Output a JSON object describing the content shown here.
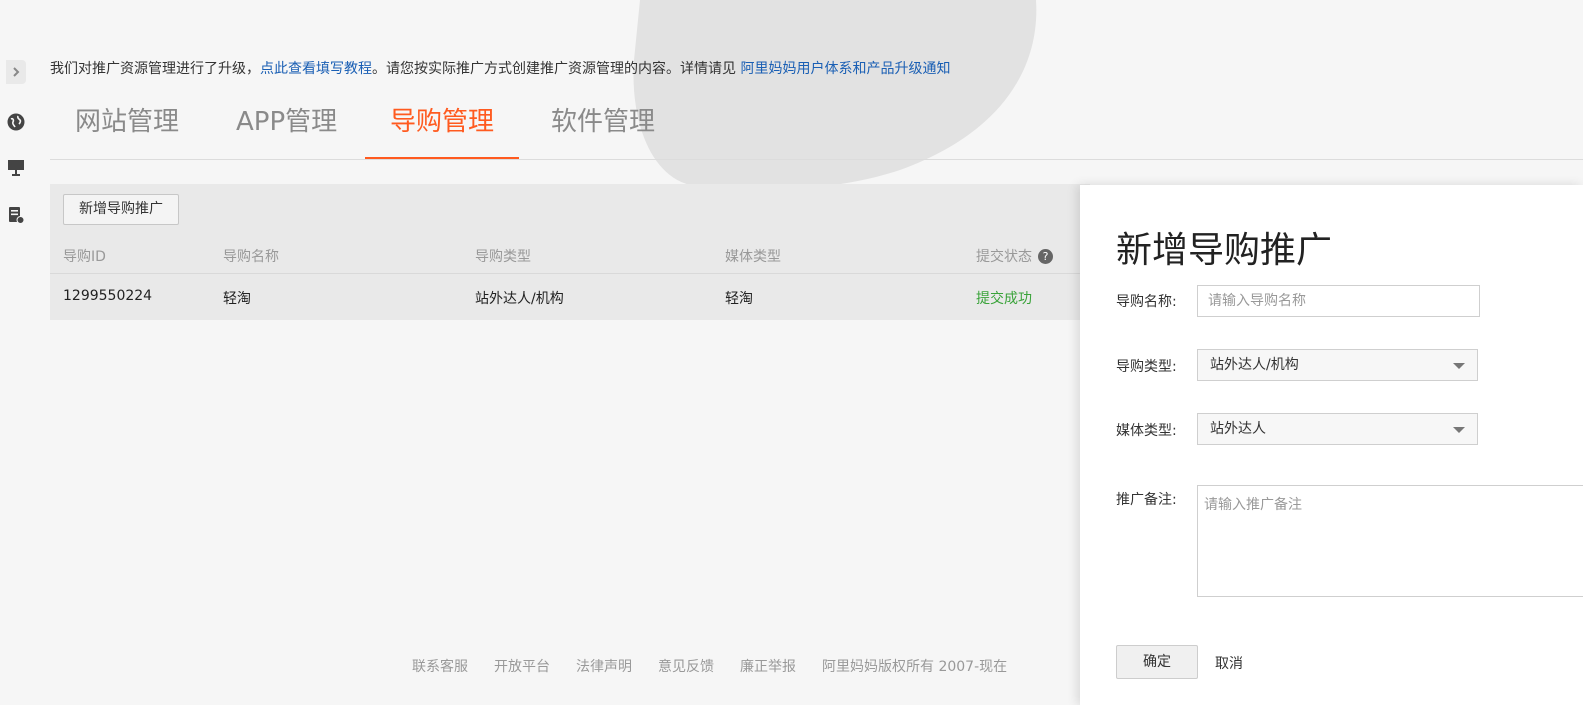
{
  "notice": {
    "prefix": "我们对推广资源管理进行了升级，",
    "tutorial_link": "点此查看填写教程",
    "middle": "。请您按实际推广方式创建推广资源管理的内容。详情请见 ",
    "upgrade_link": "阿里妈妈用户体系和产品升级通知"
  },
  "rail": {
    "toggle_icon": "chevron-right-icon",
    "icons": [
      "globe-icon",
      "monitor-icon",
      "document-list-icon"
    ]
  },
  "tabs": [
    {
      "label": "网站管理",
      "active": false
    },
    {
      "label": "APP管理",
      "active": false
    },
    {
      "label": "导购管理",
      "active": true
    },
    {
      "label": "软件管理",
      "active": false
    }
  ],
  "list": {
    "add_button": "新增导购推广",
    "columns": [
      "导购ID",
      "导购名称",
      "导购类型",
      "媒体类型",
      "提交状态"
    ],
    "help_glyph": "?",
    "rows": [
      {
        "id": "1299550224",
        "name": "轻淘",
        "type": "站外达人/机构",
        "media": "轻淘",
        "status": "提交成功"
      }
    ]
  },
  "footer": {
    "links": [
      "联系客服",
      "开放平台",
      "法律声明",
      "意见反馈",
      "廉正举报",
      "阿里妈妈版权所有 2007-现在"
    ]
  },
  "drawer": {
    "title": "新增导购推广",
    "name_label": "导购名称:",
    "name_placeholder": "请输入导购名称",
    "type_label": "导购类型:",
    "type_value": "站外达人/机构",
    "media_label": "媒体类型:",
    "media_value": "站外达人",
    "remark_label": "推广备注:",
    "remark_placeholder": "请输入推广备注",
    "ok_button": "确定",
    "cancel_button": "取消"
  },
  "colors": {
    "accent": "#ff5a1f",
    "link": "#1a5fb4",
    "success": "#3aa33a"
  }
}
